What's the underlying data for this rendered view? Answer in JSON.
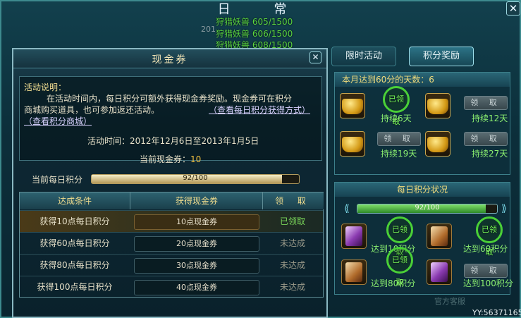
{
  "main": {
    "title": "日 常",
    "subtitle_partial": "201",
    "hunt_lines": [
      "狩猎妖兽 605/1500",
      "狩猎妖兽 606/1500",
      "狩猎妖兽 608/1500"
    ],
    "tabs": [
      "限时活动",
      "积分奖励"
    ],
    "active_tab": "积分奖励",
    "watermark": "YY:56371165",
    "bottom_ghost": "官方客服"
  },
  "reward_panel": {
    "days_header_prefix": "本月达到60分的天数：",
    "days_value": "6",
    "day_rewards": [
      {
        "label": "持续6天",
        "status": "已领取"
      },
      {
        "label": "持续12天",
        "button": "领 取"
      },
      {
        "label": "持续19天",
        "button": "领 取"
      },
      {
        "label": "持续27天",
        "button": "领 取"
      }
    ],
    "score_header": "每日积分状况",
    "score_bar_text": "92/100",
    "score_fraction": 0.92,
    "score_rewards": [
      {
        "label": "达到10积分",
        "status": "已领取"
      },
      {
        "label": "达到60积分",
        "status": "已领取"
      },
      {
        "label": "达到80积分",
        "status": "已领取"
      },
      {
        "label": "达到100积分",
        "button": "领 取"
      }
    ]
  },
  "dialog": {
    "title": "现金券",
    "close_glyph": "✕",
    "desc_label": "活动说明：",
    "desc_text_1": "在活动时间内，每日积分可额外获得现金券奖励。现金券可在积分",
    "desc_text_2": "商城购买道具，也可参加返还活动。",
    "link_score": "（查看每日积分获得方式）",
    "link_mall": "（查看积分商城）",
    "time_text": "活动时间：2012年12月6日至2013年1月5日",
    "coupon_label": "当前现金券：",
    "coupon_value": "10",
    "daily_label": "当前每日积分",
    "daily_bar_text": "92/100",
    "daily_fraction": 0.92,
    "table_headers": [
      "达成条件",
      "获得现金券",
      "领 取"
    ],
    "rows": [
      {
        "condition": "获得10点每日积分",
        "reward": "10点现金券",
        "status": "已领取"
      },
      {
        "condition": "获得60点每日积分",
        "reward": "20点现金券",
        "status": "未达成"
      },
      {
        "condition": "获得80点每日积分",
        "reward": "30点现金券",
        "status": "未达成"
      },
      {
        "condition": "获得100点每日积分",
        "reward": "40点现金券",
        "status": "未达成"
      }
    ]
  },
  "colors": {
    "claimed": "#7ad65a",
    "pending": "#9a9a8a",
    "gold": "#f2dc7c"
  }
}
